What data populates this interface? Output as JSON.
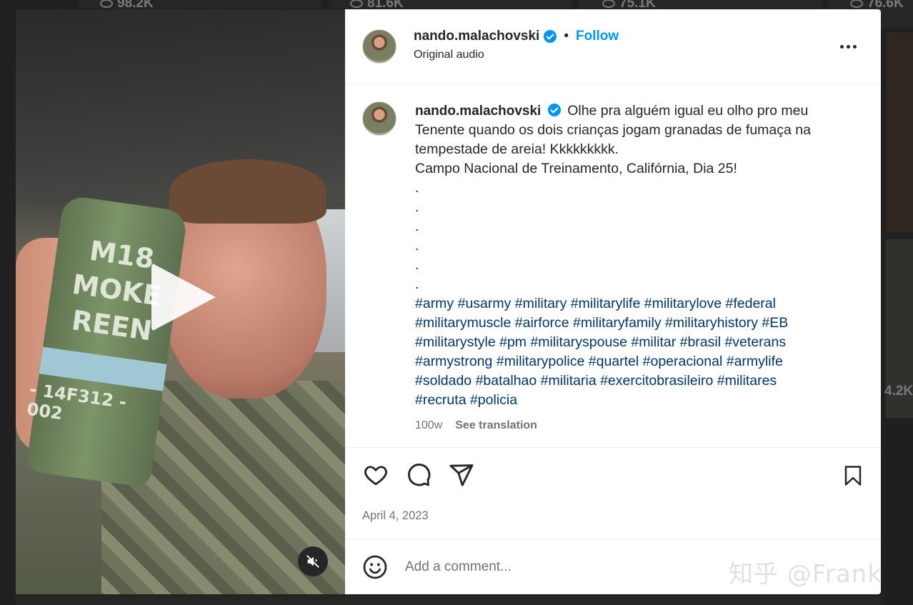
{
  "background": {
    "view_counts": [
      "98.2K",
      "81.6K",
      "75.1K",
      "76.6K",
      "4.2K"
    ]
  },
  "media": {
    "overlay_text": [
      "M18",
      "MOKE",
      "REEN"
    ],
    "serial_text": "- 14F312 - 002"
  },
  "header": {
    "username": "nando.malachovski",
    "separator": "•",
    "follow_label": "Follow",
    "subtitle": "Original audio"
  },
  "caption": {
    "username": "nando.malachovski",
    "text_line1": "Olhe pra alguém igual eu olho pro meu",
    "text_line2": "Tenente quando os dois crianças jogam granadas de fumaça na",
    "text_line3": "tempestade de areia! Kkkkkkkkk.",
    "text_line4": "Campo Nacional de Treinamento, Califórnia, Dia 25!",
    "dots": [
      ".",
      ".",
      ".",
      ".",
      ".",
      "."
    ],
    "hashtags": [
      "#army #usarmy #military #militarylife #militarylove #federal",
      "#militarymuscle #airforce #militaryfamily #militaryhistory #EB",
      "#militarystyle #pm #militaryspouse #militar #brasil #veterans",
      "#armystrong #militarypolice #quartel #operacional #armylife",
      "#soldado #batalhao #militaria #exercitobrasileiro #militares",
      "#recruta #policia"
    ],
    "age": "100w",
    "see_translation": "See translation"
  },
  "actions": {
    "icons": [
      "heart-icon",
      "comment-icon",
      "share-icon",
      "bookmark-icon"
    ],
    "date": "April 4, 2023"
  },
  "comment": {
    "placeholder": "Add a comment..."
  },
  "watermark": "知乎 @Frank",
  "colors": {
    "accent": "#0095f6",
    "hashtag": "#00376b",
    "muted": "#737373"
  }
}
